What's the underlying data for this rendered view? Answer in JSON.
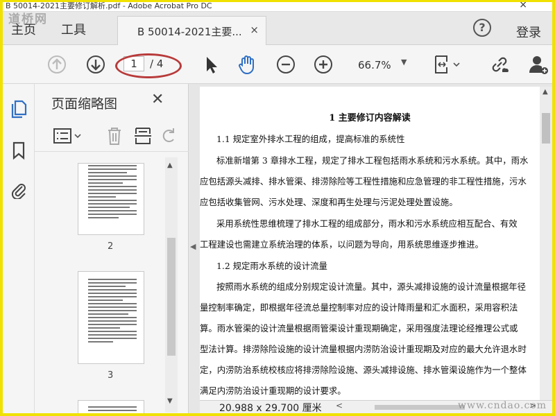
{
  "window": {
    "title": "B 50014-2021主要修订解析.pdf - Adobe Acrobat Pro DC",
    "watermark": "道桥网",
    "site_watermark": "www.cndao.com"
  },
  "tabs": {
    "home": "主页",
    "tools": "工具",
    "doc": "B 50014-2021主要...",
    "close": "×"
  },
  "header": {
    "help": "?",
    "login": "登录"
  },
  "toolbar": {
    "current_page": "1",
    "total_pages": "/ 4",
    "zoom": "66.7%",
    "zoom_arrow": "▼"
  },
  "thumbnails": {
    "title": "页面缩略图",
    "close": "✕",
    "pages": [
      "2",
      "3"
    ]
  },
  "document": {
    "heading": "1 主要修订内容解读",
    "lines": [
      "1.1 规定室外排水工程的组成，提高标准的系统性",
      "标准新增第 3 章排水工程，规定了排水工程包括雨水系统和污水系统。其中，雨水",
      "应包括源头减排、排水管渠、排涝除险等工程性措施和应急管理的非工程性措施，污水",
      "应包括收集管网、污水处理、深度和再生处理与污泥处理处置设施。",
      "采用系统性思维梳理了排水工程的组成部分，雨水和污水系统应相互配合、有效",
      "工程建设也需建立系统治理的体系，以问题为导向，用系统思维逐步推进。",
      "1.2 规定雨水系统的设计流量",
      "按照雨水系统的组成分别规定设计流量。其中，源头减排设施的设计流量根据年径",
      "量控制率确定，即根据年径流总量控制率对应的设计降雨量和汇水面积，采用容积法",
      "算。雨水管渠的设计流量根据雨管渠设计重现期确定，采用强度法理论经推理公式或",
      "型法计算。排涝除险设施的设计流量根据内涝防治设计重现期及对应的最大允许退水时",
      "定，内涝防治系统校核应将排涝除险设施、源头减排设施、排水管渠设施作为一个整体",
      "满足内涝防治设计重现期的设计要求。"
    ]
  },
  "statusbar": {
    "dimensions": "20.988 x 29.700 厘米"
  }
}
